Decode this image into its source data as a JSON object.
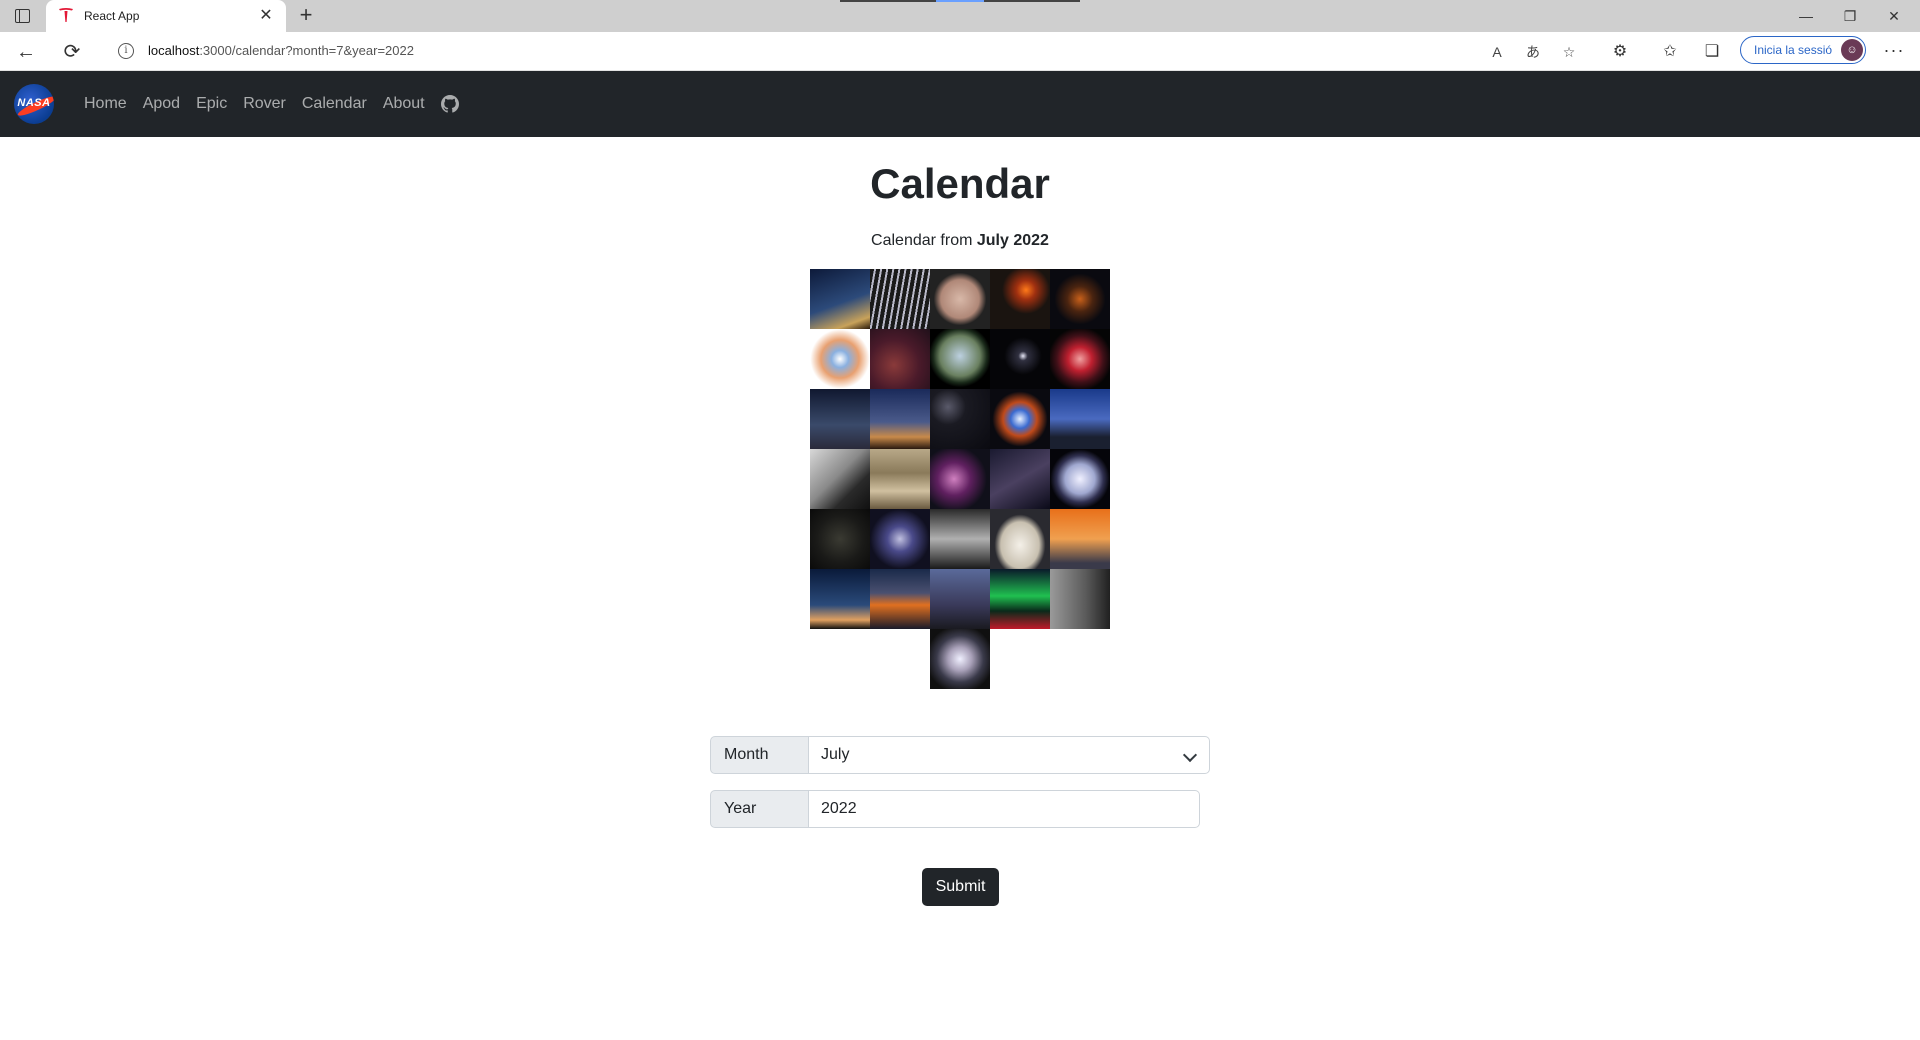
{
  "browser": {
    "tab_title": "React App",
    "tab_close": "✕",
    "new_tab": "+",
    "url_host": "localhost",
    "url_path": ":3000/calendar?month=7&year=2022",
    "signin_label": "Inicia la sessió",
    "more": "···"
  },
  "navbar": {
    "logo_text": "NASA",
    "links": [
      "Home",
      "Apod",
      "Epic",
      "Rover",
      "Calendar",
      "About"
    ]
  },
  "page": {
    "title": "Calendar",
    "subtitle_prefix": "Calendar from",
    "subtitle_date": "July 2022"
  },
  "calendar": {
    "days_count": 31,
    "columns": 5
  },
  "form": {
    "month_label": "Month",
    "month_value": "July",
    "year_label": "Year",
    "year_value": "2022",
    "submit_label": "Submit"
  },
  "colors": {
    "navbar_bg": "#212529",
    "button_bg": "#212529",
    "label_bg": "#e9ecef",
    "signin_blue": "#2b66c7"
  }
}
